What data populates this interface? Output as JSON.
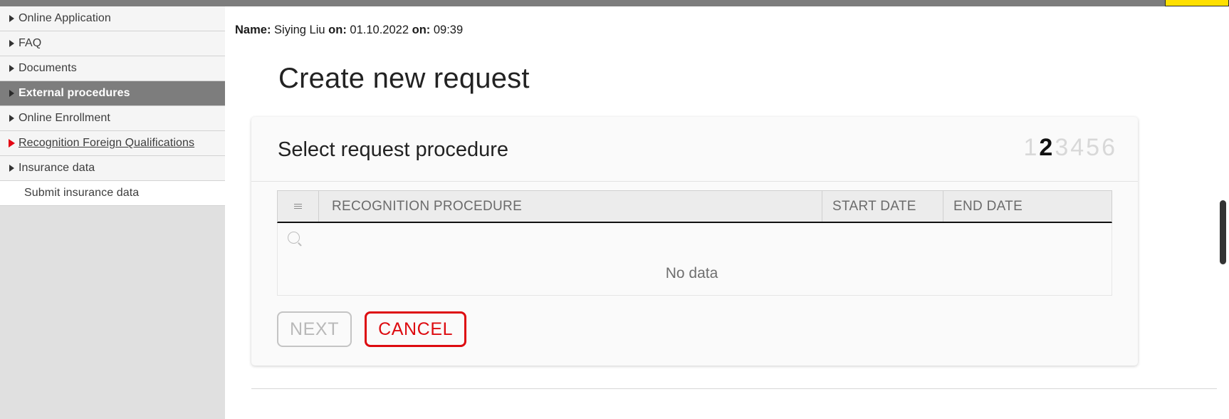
{
  "topbar": {
    "tab_label": ""
  },
  "sidebar": {
    "items": [
      {
        "label": "Online Application",
        "icon": "caret-right-icon",
        "state": "normal"
      },
      {
        "label": "FAQ",
        "icon": "caret-right-icon",
        "state": "normal"
      },
      {
        "label": "Documents",
        "icon": "caret-right-icon",
        "state": "normal"
      },
      {
        "label": "External procedures",
        "icon": "caret-right-icon",
        "state": "active"
      },
      {
        "label": "Online Enrollment",
        "icon": "caret-right-icon",
        "state": "normal"
      },
      {
        "label": "Recognition Foreign Qualifications",
        "icon": "caret-right-red-icon",
        "state": "link"
      },
      {
        "label": "Insurance data",
        "icon": "caret-right-icon",
        "state": "normal"
      },
      {
        "label": "Submit insurance data",
        "icon": "none",
        "state": "sub"
      }
    ]
  },
  "header": {
    "name_label": "Name:",
    "name_value": "Siying Liu",
    "date_label": "on:",
    "date_value": "01.10.2022",
    "time_label": "on:",
    "time_value": "09:39"
  },
  "main": {
    "page_title": "Create new request",
    "card": {
      "title": "Select request procedure",
      "steps": [
        "1",
        "2",
        "3",
        "4",
        "5",
        "6"
      ],
      "current_step": "2",
      "table": {
        "columns": [
          "",
          "RECOGNITION PROCEDURE",
          "START DATE",
          "END DATE"
        ],
        "select_column_icon": "menu-icon",
        "filter_icon": "search-icon",
        "filter_value": "",
        "filter_placeholder": "",
        "rows": [],
        "empty_message": "No data"
      },
      "buttons": {
        "next_label": "NEXT",
        "next_disabled": true,
        "cancel_label": "CANCEL"
      }
    }
  },
  "colors": {
    "accent_red": "#dd0b10",
    "active_nav_bg": "#7d7d7d",
    "link_arrow_red": "#e30613",
    "topbar_gray": "#7d7d7d",
    "tab_yellow": "#ffe000",
    "card_bg": "#fafafa",
    "table_header_bg": "#ececec"
  },
  "scrollbar": {
    "orientation": "vertical",
    "position": "right"
  }
}
